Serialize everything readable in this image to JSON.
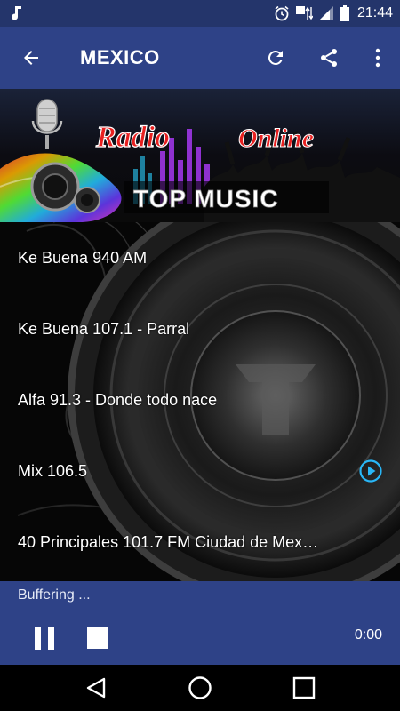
{
  "status_bar": {
    "time": "21:44",
    "icons": [
      "music-note-icon",
      "alarm-icon",
      "network-4g-icon",
      "signal-icon",
      "battery-icon"
    ],
    "network_label": "4G"
  },
  "app_bar": {
    "title": "MEXICO",
    "back_icon": "arrow-back-icon",
    "actions": [
      "refresh-icon",
      "share-icon",
      "more-vert-icon"
    ]
  },
  "banner": {
    "line1": "Radio",
    "line2": "Online",
    "line3": "TOP MUSIC"
  },
  "stations": [
    {
      "name": "Ke Buena 940 AM",
      "playing": false
    },
    {
      "name": "Ke Buena 107.1 - Parral",
      "playing": false
    },
    {
      "name": "Alfa 91.3 - Donde todo nace",
      "playing": false
    },
    {
      "name": "Mix 106.5",
      "playing": true
    },
    {
      "name": "40 Principales 101.7 FM Ciudad de Mex…",
      "playing": false
    }
  ],
  "player": {
    "status": "Buffering ...",
    "elapsed": "0:00"
  },
  "colors": {
    "status_bar": "#24356b",
    "app_bar": "#2e4287",
    "accent_play": "#29b6f6"
  }
}
